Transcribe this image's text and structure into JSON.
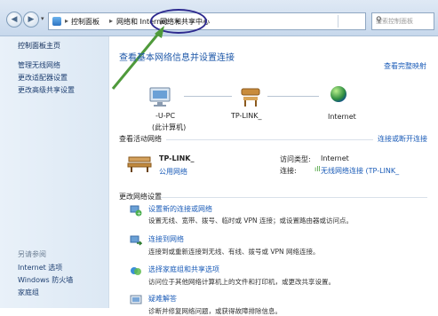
{
  "address_bar": {
    "crumbs": [
      "控制面板",
      "网络和 Internet",
      "网络和共享中心"
    ],
    "search_placeholder": "搜索控制面板"
  },
  "sidebar": {
    "items": [
      {
        "label": "控制面板主页"
      },
      {
        "label": "管理无线网络"
      },
      {
        "label": "更改适配器设置"
      },
      {
        "label": "更改高级共享设置"
      }
    ],
    "see_also_label": "另请参阅",
    "see_also_items": [
      {
        "label": "Internet 选项"
      },
      {
        "label": "Windows 防火墙"
      },
      {
        "label": "家庭组"
      }
    ]
  },
  "main": {
    "title": "查看基本网络信息并设置连接",
    "view_full_map": "查看完整映射",
    "map": {
      "computer_name": "-U-PC",
      "computer_sub": "(此计算机)",
      "router_name": "TP-LINK_",
      "internet": "Internet"
    },
    "active_networks_label": "查看活动网络",
    "connect_or_disconnect": "连接或断开连接",
    "network": {
      "name": "TP-LINK_",
      "type_link": "公用网络",
      "access_type_label": "访问类型:",
      "access_type_value": "Internet",
      "connection_label": "连接:",
      "connection_value": "无线网络连接 (TP-LINK_"
    },
    "change_settings_label": "更改网络设置",
    "tasks": [
      {
        "title": "设置新的连接或网络",
        "desc": "设置无线、宽带、拨号、临时或 VPN 连接；或设置路由器或访问点。"
      },
      {
        "title": "连接到网络",
        "desc": "连接到或重新连接到无线、有线、拨号或 VPN 网络连接。"
      },
      {
        "title": "选择家庭组和共享选项",
        "desc": "访问位于其他网络计算机上的文件和打印机，或更改共享设置。"
      },
      {
        "title": "疑难解答",
        "desc": "诊断并修复网络问题，或获得故障排除信息。"
      }
    ]
  }
}
